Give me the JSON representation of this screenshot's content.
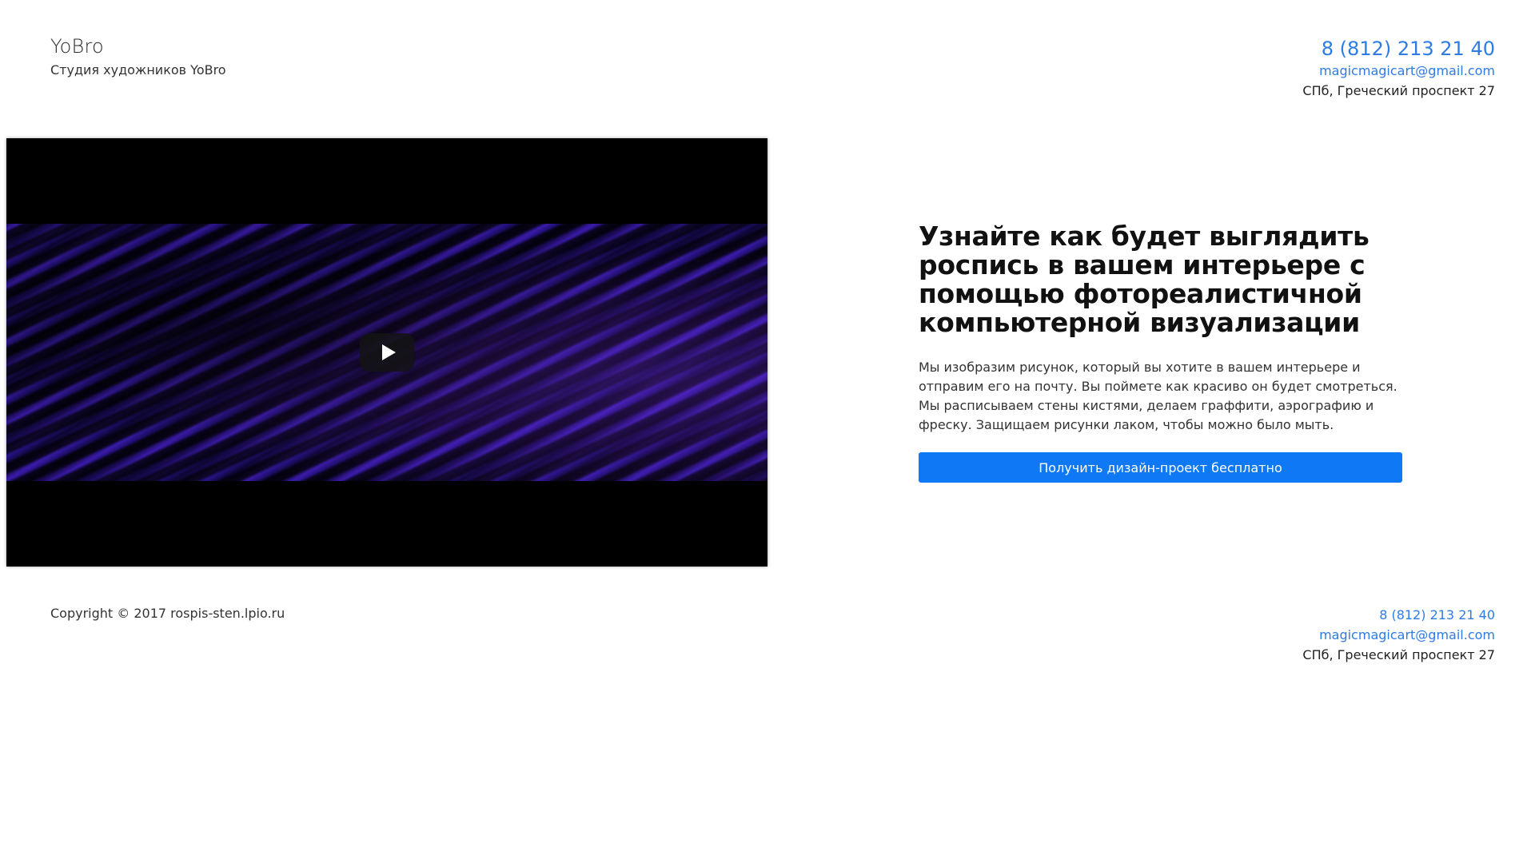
{
  "header": {
    "brand": "YoBro",
    "tagline": "Студия художников YoBro",
    "phone": "8 (812) 213 21 40",
    "email": "magicmagicart@gmail.com",
    "address": "СПб, Греческий проспект 27"
  },
  "video": {
    "play_icon": "play-icon"
  },
  "promo": {
    "title": "Узнайте как будет выглядить роспись в вашем интерьере с помощью фотореалистичной компьютерной визуализации",
    "text": "Мы изобразим рисунок, который вы хотите в вашем интерьере и отправим его на почту. Вы поймете как красиво он будет смотреться. Мы расписываем стены кистями, делаем граффити, аэрографию и фреску. Защищаем рисунки лаком, чтобы можно было мыть.",
    "cta_label": "Получить дизайн-проект бесплатно"
  },
  "footer": {
    "copyright": "Copyright © 2017 rospis-sten.lpio.ru",
    "phone": "8 (812) 213 21 40",
    "email": "magicmagicart@gmail.com",
    "address": "СПб, Греческий проспект 27"
  },
  "colors": {
    "link": "#2d7be5",
    "button": "#0f78f5",
    "video_bg": "#000000"
  }
}
